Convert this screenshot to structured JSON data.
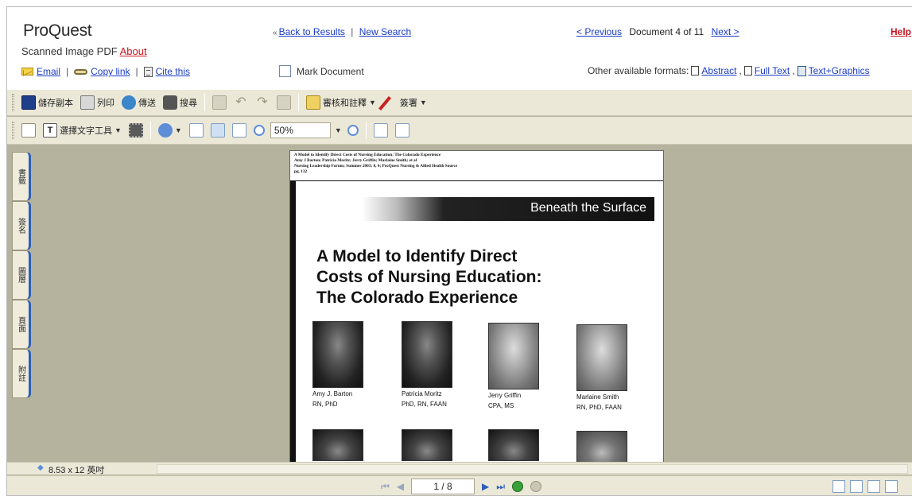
{
  "header": {
    "logo": "ProQuest",
    "subtitle": "Scanned Image PDF",
    "about_link": "About",
    "email_link": "Email",
    "copylink_link": "Copy link",
    "cite_link": "Cite this",
    "back_link": "Back to Results",
    "new_search_link": "New Search",
    "mark_document": "Mark Document",
    "previous_link": "< Previous",
    "doc_counter": "Document 4 of 11",
    "next_link": "Next >",
    "help_link": "Help",
    "formats_label": "Other available formats:",
    "format_abstract": "Abstract",
    "format_fulltext": "Full Text",
    "format_textgraphics": "Text+Graphics"
  },
  "toolbar1": {
    "save": "儲存副本",
    "print": "列印",
    "send": "傳送",
    "search": "搜尋",
    "review": "審核和註釋",
    "sign": "簽署"
  },
  "toolbar2": {
    "select_text": "選擇文字工具",
    "zoom_value": "50%"
  },
  "sidetabs": [
    "書籤",
    "簽名",
    "圖層",
    "頁面",
    "附註"
  ],
  "document": {
    "cite_lines": [
      "A Model to Identify Direct Costs of Nursing Education: The Colorado Experience",
      "Amy J Barton; Patricia Moritz; Jerry Griffin; Marlaine Smith; et al",
      "Nursing Leadership Forum; Summer 2003; 8, 4; ProQuest Nursing & Allied Health Source",
      "pg. 132"
    ],
    "banner": "Beneath the Surface",
    "title_lines": [
      "A Model to Identify Direct",
      "Costs of Nursing Education:",
      "The Colorado Experience"
    ],
    "authors": [
      {
        "name": "Amy J. Barton",
        "creds": "RN, PhD"
      },
      {
        "name": "Patricia Moritz",
        "creds": "PhD, RN, FAAN"
      },
      {
        "name": "Jerry Griffin",
        "creds": "CPA, MS"
      },
      {
        "name": "Marlaine Smith",
        "creds": "RN, PhD, FAAN"
      }
    ]
  },
  "status": {
    "page_size": "8.53 x 12 英吋",
    "page_indicator": "1 / 8"
  },
  "colors": {
    "link": "#1a3cc8",
    "help": "#c8141e",
    "viewer_bg": "#b5b29e",
    "toolbar_bg": "#ebe8d8"
  }
}
